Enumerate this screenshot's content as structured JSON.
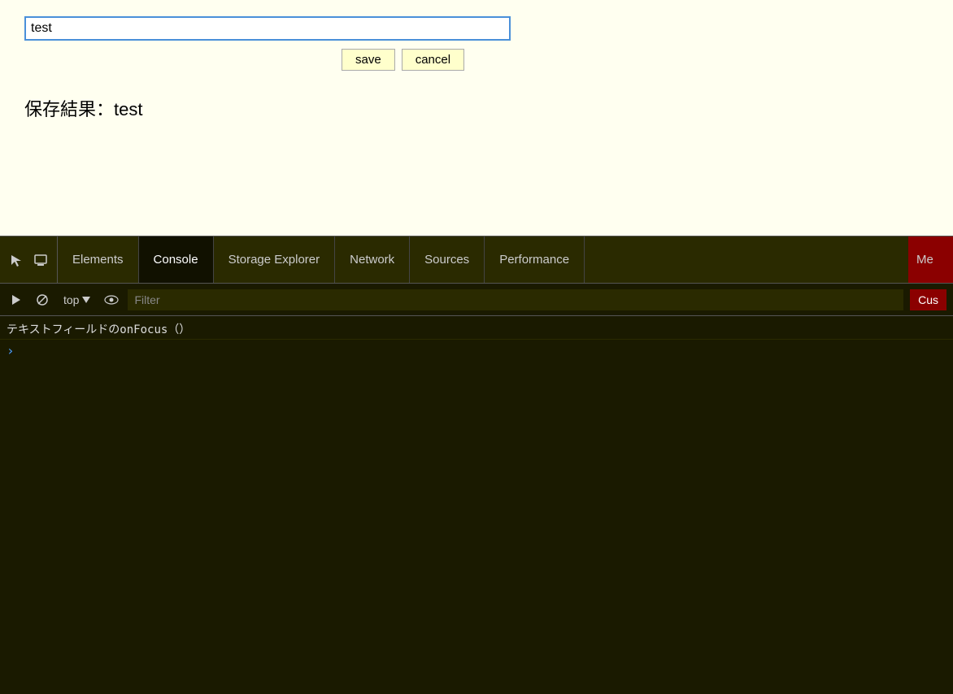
{
  "page": {
    "background": "#fffff0"
  },
  "input": {
    "value": "test",
    "placeholder": ""
  },
  "buttons": {
    "save_label": "save",
    "cancel_label": "cancel"
  },
  "result_text": "保存結果：test",
  "devtools": {
    "tabs": [
      {
        "label": "Elements",
        "active": false
      },
      {
        "label": "Console",
        "active": true
      },
      {
        "label": "Storage Explorer",
        "active": false
      },
      {
        "label": "Network",
        "active": false
      },
      {
        "label": "Sources",
        "active": false
      },
      {
        "label": "Performance",
        "active": false
      }
    ],
    "more_label": "Me",
    "context": "top",
    "filter_placeholder": "Filter",
    "custom_label": "Cus",
    "console_log": "テキストフィールドのonFocus（）"
  },
  "icons": {
    "cursor_icon": "↖",
    "device_icon": "⬜",
    "play_icon": "▶",
    "block_icon": "⊘",
    "dropdown_icon": "▼",
    "eye_icon": "👁"
  }
}
